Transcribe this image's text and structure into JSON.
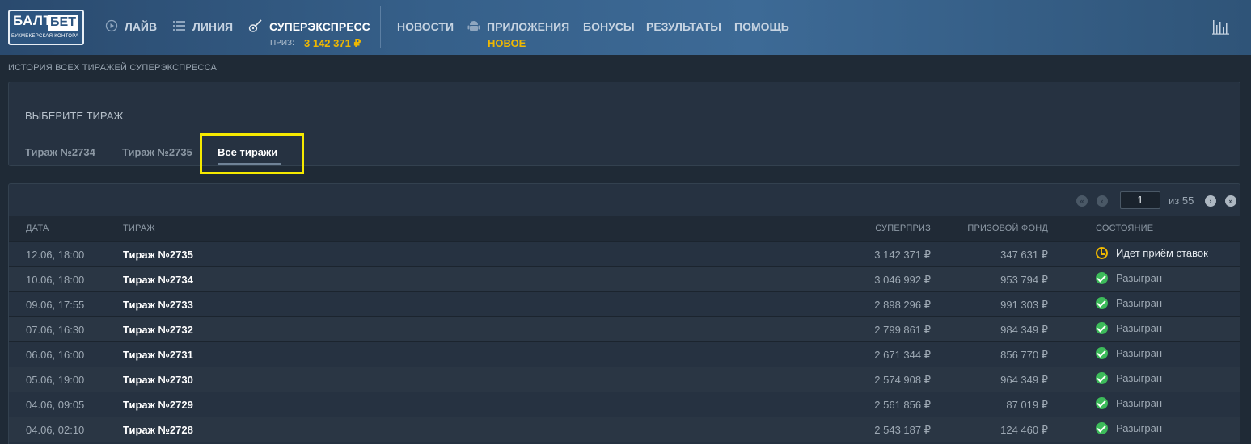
{
  "header": {
    "logo": {
      "top": "БАЛТ",
      "top2": "БЕТ",
      "sub": "БУКМЕКЕРСКАЯ КОНТОРА"
    },
    "nav": {
      "live": "ЛАЙВ",
      "line": "ЛИНИЯ",
      "superexpress": "СУПЕРЭКСПРЕСС",
      "prize_label": "ПРИЗ:",
      "prize_value": "3 142 371 ₽",
      "news": "НОВОСТИ",
      "apps": "ПРИЛОЖЕНИЯ",
      "apps_badge": "НОВОЕ",
      "bonuses": "БОНУСЫ",
      "results": "РЕЗУЛЬТАТЫ",
      "help": "ПОМОЩЬ"
    },
    "icons": [
      "play-icon",
      "list-icon",
      "guitar-icon",
      "android-icon",
      "stats-icon"
    ]
  },
  "breadcrumb": "ИСТОРИЯ ВСЕХ ТИРАЖЕЙ СУПЕРЭКСПРЕССА",
  "select_panel": {
    "title": "ВЫБЕРИТЕ ТИРАЖ",
    "tabs": [
      {
        "label": "Тираж №2734"
      },
      {
        "label": "Тираж №2735"
      },
      {
        "label": "Все тиражи"
      }
    ],
    "active_tab": "Все тиражи"
  },
  "pager": {
    "current": "1",
    "of_text": "из 55"
  },
  "table": {
    "headers": {
      "date": "ДАТА",
      "draw": "ТИРАЖ",
      "superprize": "СУПЕРПРИЗ",
      "fund": "ПРИЗОВОЙ ФОНД",
      "status": "СОСТОЯНИЕ"
    },
    "rows": [
      {
        "date": "12.06, 18:00",
        "draw": "Тираж №2735",
        "superprize": "3 142 371 ₽",
        "fund": "347 631 ₽",
        "status": "Идет приём ставок",
        "state": "live"
      },
      {
        "date": "10.06, 18:00",
        "draw": "Тираж №2734",
        "superprize": "3 046 992 ₽",
        "fund": "953 794 ₽",
        "status": "Разыгран",
        "state": "done"
      },
      {
        "date": "09.06, 17:55",
        "draw": "Тираж №2733",
        "superprize": "2 898 296 ₽",
        "fund": "991 303 ₽",
        "status": "Разыгран",
        "state": "done"
      },
      {
        "date": "07.06, 16:30",
        "draw": "Тираж №2732",
        "superprize": "2 799 861 ₽",
        "fund": "984 349 ₽",
        "status": "Разыгран",
        "state": "done"
      },
      {
        "date": "06.06, 16:00",
        "draw": "Тираж №2731",
        "superprize": "2 671 344 ₽",
        "fund": "856 770 ₽",
        "status": "Разыгран",
        "state": "done"
      },
      {
        "date": "05.06, 19:00",
        "draw": "Тираж №2730",
        "superprize": "2 574 908 ₽",
        "fund": "964 349 ₽",
        "status": "Разыгран",
        "state": "done"
      },
      {
        "date": "04.06, 09:05",
        "draw": "Тираж №2729",
        "superprize": "2 561 856 ₽",
        "fund": "87 019 ₽",
        "status": "Разыгран",
        "state": "done"
      },
      {
        "date": "04.06, 02:10",
        "draw": "Тираж №2728",
        "superprize": "2 543 187 ₽",
        "fund": "124 460 ₽",
        "status": "Разыгран",
        "state": "done"
      }
    ]
  },
  "colors": {
    "accent": "#f0b800",
    "success": "#3dbb5a",
    "highlight": "#f5e900"
  }
}
